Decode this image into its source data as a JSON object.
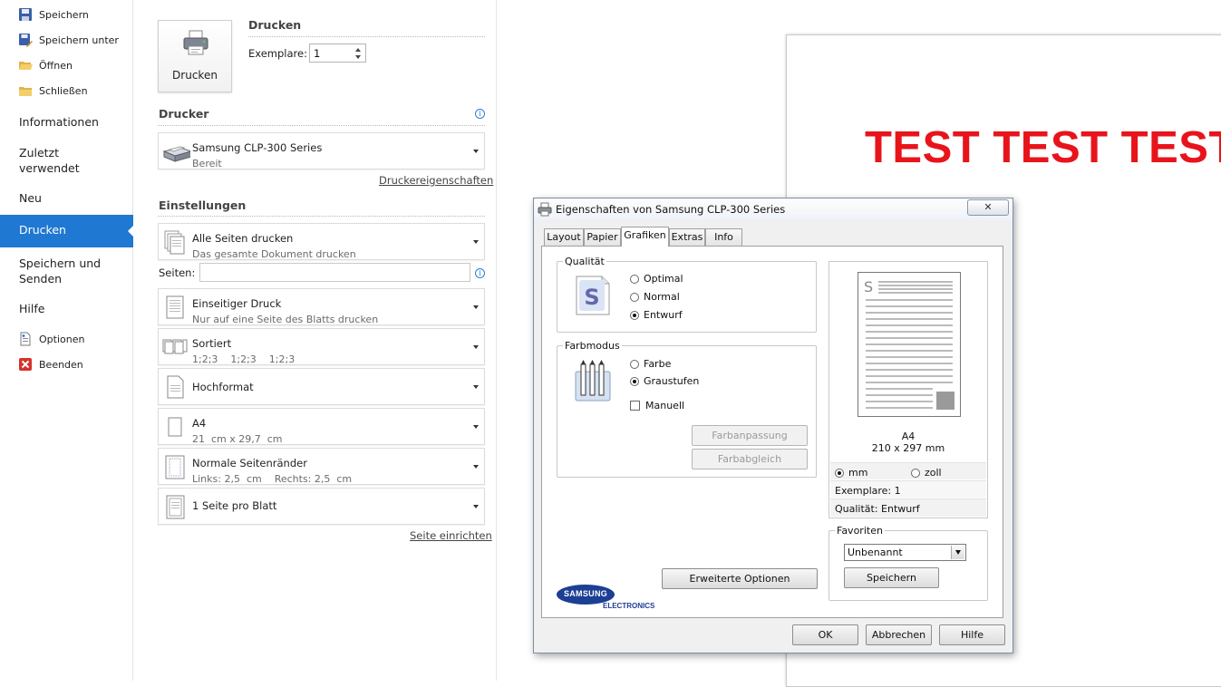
{
  "nav": {
    "save": "Speichern",
    "save_as": "Speichern unter",
    "open": "Öffnen",
    "close": "Schließen",
    "info": "Informationen",
    "recent_1": "Zuletzt",
    "recent_2": "verwendet",
    "new": "Neu",
    "print": "Drucken",
    "share_1": "Speichern und",
    "share_2": "Senden",
    "help": "Hilfe",
    "options": "Optionen",
    "exit": "Beenden"
  },
  "print_panel": {
    "print_button": "Drucken",
    "print_header": "Drucken",
    "copies_label": "Exemplare:",
    "copies_value": "1",
    "printer_header": "Drucker",
    "printer_name": "Samsung CLP-300 Series",
    "printer_status": "Bereit",
    "printer_props_link": "Druckereigenschaften",
    "settings_header": "Einstellungen",
    "pages_label": "Seiten:",
    "pages_value": "",
    "page_setup_link": "Seite einrichten",
    "settings": [
      {
        "title": "Alle Seiten drucken",
        "sub": "Das gesamte Dokument drucken"
      },
      {
        "title": "Einseitiger Druck",
        "sub": "Nur auf eine Seite des Blatts drucken"
      },
      {
        "title": "Sortiert",
        "sub": "1;2;3    1;2;3    1;2;3"
      },
      {
        "title": "Hochformat"
      },
      {
        "title": "A4",
        "sub": "21  cm x 29,7  cm"
      },
      {
        "title": "Normale Seitenränder",
        "sub": "Links: 2,5  cm    Rechts: 2,5  cm"
      },
      {
        "title": "1 Seite pro Blatt"
      }
    ]
  },
  "preview": {
    "document_text": "TEST TEST TEST"
  },
  "dialog": {
    "title": "Eigenschaften von Samsung CLP-300 Series",
    "close_glyph": "✕",
    "tabs": [
      "Layout",
      "Papier",
      "Grafiken",
      "Extras",
      "Info"
    ],
    "active_tab": "Grafiken",
    "quality": {
      "legend": "Qualität",
      "options": [
        "Optimal",
        "Normal",
        "Entwurf"
      ],
      "selected": "Entwurf"
    },
    "color_mode": {
      "legend": "Farbmodus",
      "options": [
        "Farbe",
        "Graustufen"
      ],
      "selected": "Graustufen",
      "manual_label": "Manuell",
      "manual_checked": false,
      "color_adjust_button": "Farbanpassung",
      "color_match_button": "Farbabgleich"
    },
    "advanced_button": "Erweiterte Optionen",
    "brand_1": "SAMSUNG",
    "brand_2": "ELECTRONICS",
    "preview_box": {
      "paper_name": "A4",
      "paper_size": "210 x 297 mm",
      "unit_options": [
        "mm",
        "zoll"
      ],
      "unit_selected": "mm",
      "copies_text": "Exemplare: 1",
      "quality_text": "Qualität: Entwurf"
    },
    "favorites": {
      "legend": "Favoriten",
      "selected": "Unbenannt",
      "save_button": "Speichern"
    },
    "ok_button": "OK",
    "cancel_button": "Abbrechen",
    "help_button": "Hilfe"
  },
  "colors": {
    "accent_blue": "#1f78d1",
    "preview_red": "#e8141b"
  }
}
